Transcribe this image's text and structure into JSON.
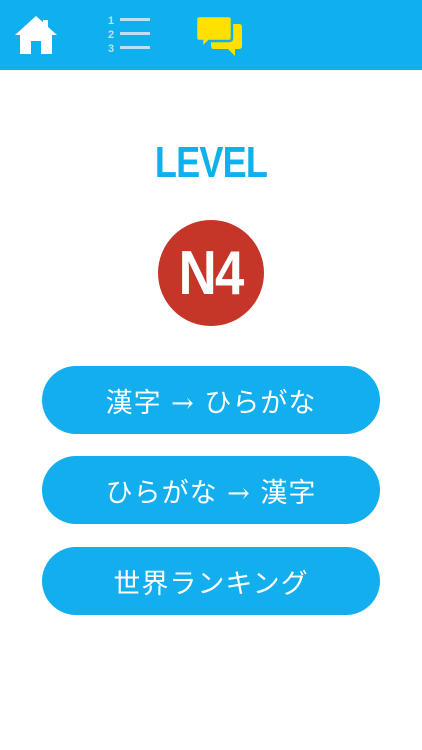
{
  "topbar": {
    "home_icon": "home-icon",
    "list_icon": "numbered-list-icon",
    "list_numbers": [
      "1",
      "2",
      "3"
    ],
    "chat_icon": "chat-bubbles-icon"
  },
  "colors": {
    "accent": "#0fb0ee",
    "badge": "#c63628",
    "chat_icon": "#ffe000"
  },
  "main": {
    "title": "LEVEL",
    "level_badge": "N4",
    "buttons": [
      {
        "label": "漢字 → ひらがな"
      },
      {
        "label": "ひらがな → 漢字"
      },
      {
        "label": "世界ランキング"
      }
    ]
  }
}
